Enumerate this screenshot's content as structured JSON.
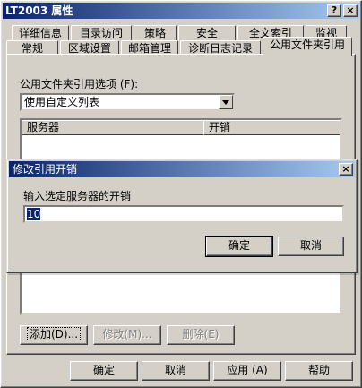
{
  "window": {
    "title": "LT2003 属性",
    "help_btn": "?",
    "close_btn": "×"
  },
  "tabs_row1": [
    "详细信息",
    "目录访问",
    "策略",
    "安全",
    "全文索引",
    "监视"
  ],
  "tabs_row2": [
    "常规",
    "区域设置",
    "邮箱管理",
    "诊断日志记录",
    "公用文件夹引用"
  ],
  "panel": {
    "option_label": "公用文件夹引用选项 (F):",
    "option_value": "使用自定义列表",
    "col_server": "服务器",
    "col_cost": "开销",
    "add_button": "添加(D)...",
    "modify_button": "修改(M)...",
    "delete_button": "删除(E)"
  },
  "footer": {
    "ok": "确定",
    "cancel": "取消",
    "apply": "应用 (A)",
    "help": "帮助"
  },
  "dialog": {
    "title": "修改引用开销",
    "prompt": "输入选定服务器的开销",
    "value": "10",
    "ok": "确定",
    "cancel": "取消",
    "close_btn": "×"
  }
}
